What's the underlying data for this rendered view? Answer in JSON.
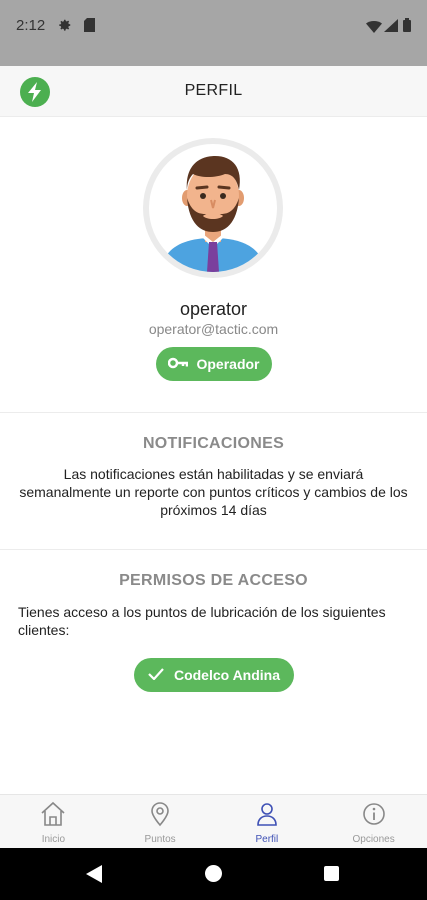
{
  "status_bar": {
    "time": "2:12"
  },
  "app_bar": {
    "title": "PERFIL"
  },
  "profile": {
    "username": "operator",
    "email": "operator@tactic.com",
    "role_label": "Operador"
  },
  "notifications": {
    "title": "NOTIFICACIONES",
    "text": "Las notificaciones  están habilitadas y  se enviará semanalmente un reporte con puntos críticos y cambios de los próximos 14 días"
  },
  "permissions": {
    "title": "PERMISOS DE ACCESO",
    "text": "Tienes acceso a los puntos de lubricación de los siguientes clientes:",
    "clients": [
      "Codelco Andina"
    ]
  },
  "bottom_nav": {
    "items": [
      {
        "label": "Inicio",
        "icon": "home-icon"
      },
      {
        "label": "Puntos",
        "icon": "location-pin-icon"
      },
      {
        "label": "Perfil",
        "icon": "person-icon"
      },
      {
        "label": "Opciones",
        "icon": "info-circle-icon"
      }
    ],
    "active": "Perfil"
  },
  "colors": {
    "accent_green": "#5cb85c",
    "active_nav": "#3f51b5",
    "status_bar_bg": "#a6a6a6"
  }
}
